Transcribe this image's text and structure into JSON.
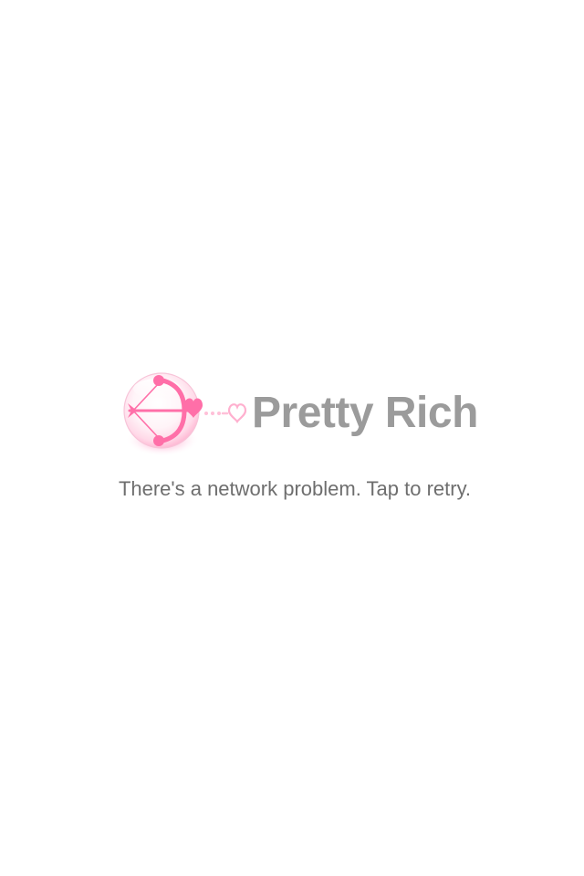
{
  "app": {
    "brand_name": "Pretty Rich",
    "logo_icon": "cupid-bow-arrow-icon",
    "accent_color": "#ff6fa8",
    "brand_text_color": "#9b9b9b"
  },
  "status": {
    "message": "There's a network problem. Tap to retry.",
    "text_color": "#6e6e6e"
  }
}
